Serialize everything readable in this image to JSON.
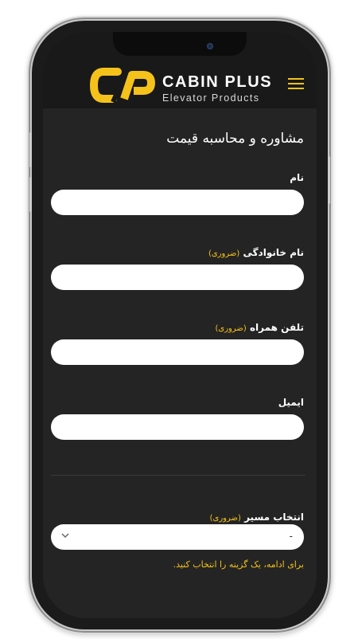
{
  "brand": {
    "name": "CABIN PLUS",
    "tagline": "Elevator Products",
    "accent_color": "#f5c21b"
  },
  "header": {
    "menu_icon": "hamburger-icon"
  },
  "form": {
    "title": "مشاوره و محاسبه قیمت",
    "required_label": "(ضروری)",
    "fields": {
      "first_name": {
        "label": "نام",
        "value": ""
      },
      "last_name": {
        "label": "نام خانوادگی",
        "value": ""
      },
      "phone": {
        "label": "تلفن همراه",
        "value": ""
      },
      "email": {
        "label": "ایمیل",
        "value": ""
      }
    },
    "route": {
      "label": "انتخاب مسیر",
      "selected": "-",
      "hint": "برای ادامه، یک گزینه را انتخاب کنید."
    }
  }
}
